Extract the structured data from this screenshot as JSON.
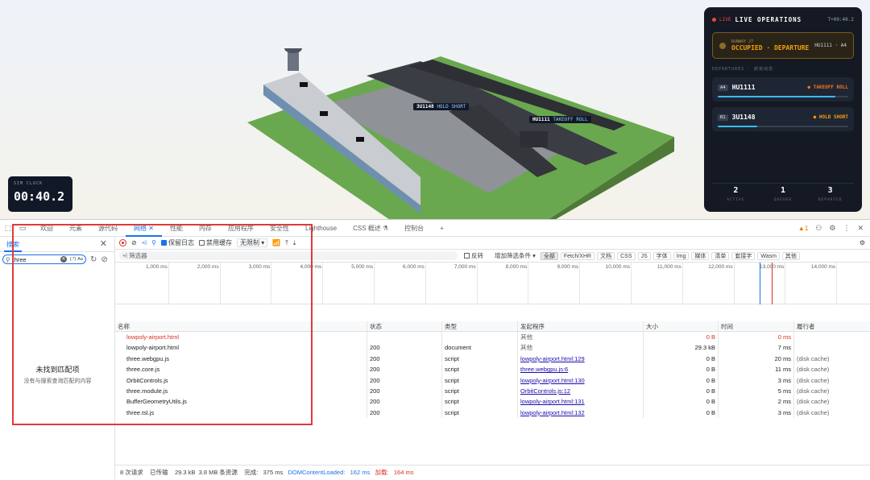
{
  "scene": {
    "tag1": {
      "flight": "3U1148",
      "state": "HOLD SHORT"
    },
    "tag2": {
      "flight": "HU1111",
      "state": "TAKEOFF ROLL"
    }
  },
  "clock": {
    "label": "SIM CLOCK",
    "value": "00:40.2"
  },
  "ops": {
    "live": "LIVE",
    "title": "LIVE OPERATIONS",
    "time": "T+00:40.2",
    "runway_name": "RUNWAY 27",
    "runway_status": "OCCUPIED · DEPARTURE",
    "runway_flight": "HU1111 · A4",
    "departures_label": "DEPARTURES · 航班动态",
    "flights": [
      {
        "gate": "A4",
        "flight": "HU1111",
        "phase": "TAKEOFF ROLL",
        "color": "#f97316",
        "progress": 0.9
      },
      {
        "gate": "B1",
        "flight": "3U1148",
        "phase": "HOLD SHORT",
        "color": "#f59e0b",
        "progress": 0.3
      }
    ],
    "stats": [
      {
        "value": "2",
        "label": "ACTIVE"
      },
      {
        "value": "1",
        "label": "QUEUED"
      },
      {
        "value": "3",
        "label": "DEPARTED"
      }
    ]
  },
  "tabs": [
    "欢迎",
    "元素",
    "源代码",
    "网络",
    "性能",
    "内存",
    "应用程序",
    "安全性",
    "Lighthouse",
    "CSS 概述",
    "控制台"
  ],
  "warnings": "1",
  "search": {
    "tab": "搜索",
    "query": "three",
    "opt_regex": "(.*)",
    "opt_case": "Aa",
    "no_match_title": "未找到匹配项",
    "no_match_desc": "没有与搜索查询匹配的内容"
  },
  "toolbar": {
    "preserve_log": "保留日志",
    "disable_cache": "禁用缓存",
    "throttle": "无限制"
  },
  "filter": {
    "placeholder": "筛选器",
    "invert": "反转",
    "more_filters": "增加筛选条件",
    "types": [
      "全部",
      "Fetch/XHR",
      "文档",
      "CSS",
      "JS",
      "字体",
      "Img",
      "媒体",
      "清单",
      "套接字",
      "Wasm",
      "其他"
    ]
  },
  "overview_ticks": [
    "1,000 ms",
    "2,000 ms",
    "3,000 ms",
    "4,000 ms",
    "5,000 ms",
    "6,000 ms",
    "7,000 ms",
    "8,000 ms",
    "9,000 ms",
    "10,000 ms",
    "11,000 ms",
    "12,000 ms",
    "13,000 ms",
    "14,000 ms",
    "15,"
  ],
  "columns": [
    "名称",
    "状态",
    "类型",
    "发起程序",
    "大小",
    "时间",
    "履行者"
  ],
  "requests": [
    {
      "name": "lowpoly-airport.html",
      "status": "",
      "type": "",
      "initiator": "其他",
      "size": "0 B",
      "time": "0 ms",
      "fulfilled": "",
      "error": true,
      "link": false
    },
    {
      "name": "lowpoly-airport.html",
      "status": "200",
      "type": "document",
      "initiator": "其他",
      "size": "29.3 kB",
      "time": "7 ms",
      "fulfilled": "",
      "error": false,
      "link": false
    },
    {
      "name": "three.webgpu.js",
      "status": "200",
      "type": "script",
      "initiator": "lowpoly-airport.html:129",
      "size": "0 B",
      "time": "20 ms",
      "fulfilled": "(disk cache)",
      "error": false,
      "link": true
    },
    {
      "name": "three.core.js",
      "status": "200",
      "type": "script",
      "initiator": "three.webgpu.js:6",
      "size": "0 B",
      "time": "11 ms",
      "fulfilled": "(disk cache)",
      "error": false,
      "link": true
    },
    {
      "name": "OrbitControls.js",
      "status": "200",
      "type": "script",
      "initiator": "lowpoly-airport.html:130",
      "size": "0 B",
      "time": "3 ms",
      "fulfilled": "(disk cache)",
      "error": false,
      "link": true
    },
    {
      "name": "three.module.js",
      "status": "200",
      "type": "script",
      "initiator": "OrbitControls.js:12",
      "size": "0 B",
      "time": "5 ms",
      "fulfilled": "(disk cache)",
      "error": false,
      "link": true
    },
    {
      "name": "BufferGeometryUtils.js",
      "status": "200",
      "type": "script",
      "initiator": "lowpoly-airport.html:131",
      "size": "0 B",
      "time": "2 ms",
      "fulfilled": "(disk cache)",
      "error": false,
      "link": true
    },
    {
      "name": "three.tsl.js",
      "status": "200",
      "type": "script",
      "initiator": "lowpoly-airport.html:132",
      "size": "0 B",
      "time": "3 ms",
      "fulfilled": "(disk cache)",
      "error": false,
      "link": true
    }
  ],
  "statusbar": {
    "requests": "8 次请求",
    "transferred": "已传输",
    "transferred_val": "29.3 kB",
    "resources": "3.8 MB 条资源",
    "finish_label": "完成:",
    "finish": "375 ms",
    "dcl_label": "DOMContentLoaded:",
    "dcl": "162 ms",
    "load_label": "加载:",
    "load": "164 ms"
  }
}
